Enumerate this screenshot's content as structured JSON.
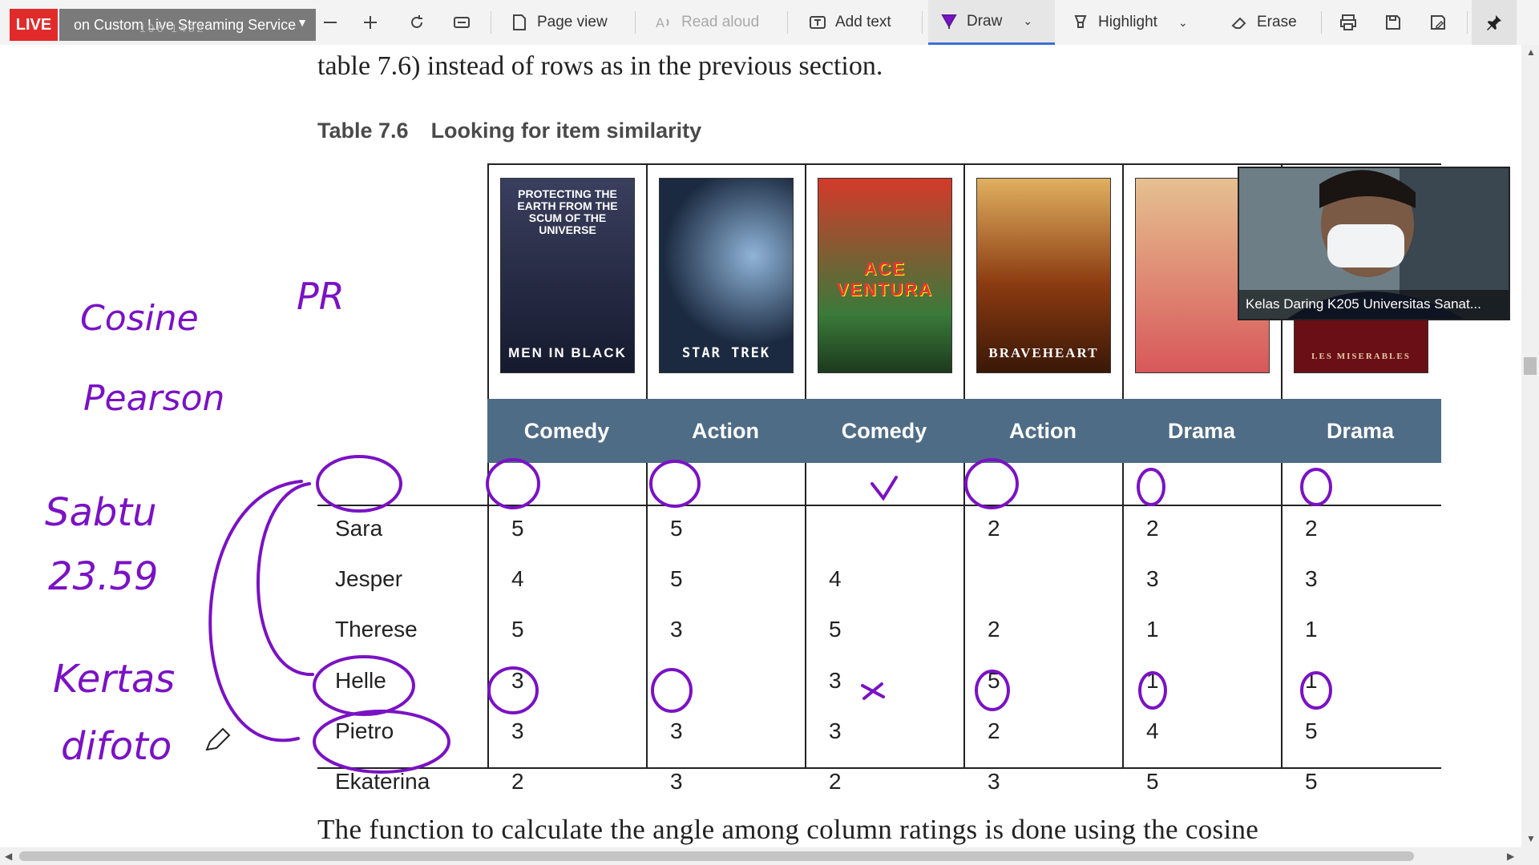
{
  "overlay": {
    "live_label": "LIVE",
    "ghost_text": "196  1432",
    "stream_service": "on Custom Live Streaming Service"
  },
  "toolbar": {
    "page_view": "Page view",
    "read_aloud": "Read aloud",
    "add_text": "Add text",
    "draw": "Draw",
    "highlight": "Highlight",
    "erase": "Erase"
  },
  "document": {
    "top_line": "table 7.6) instead of rows as in the previous section.",
    "table_number": "Table 7.6",
    "table_title": "Looking for item similarity",
    "bottom_line": "The function to calculate the angle among column ratings is done using the cosine",
    "posters": [
      "MEN IN BLACK",
      "STAR TREK",
      "ACE VENTURA",
      "BRAVEHEART",
      "",
      "LES MISERABLES"
    ],
    "genres": [
      "Comedy",
      "Action",
      "Comedy",
      "Action",
      "Drama",
      "Drama"
    ],
    "rows": [
      {
        "name": "Sara",
        "ratings": [
          "5",
          "5",
          "",
          "2",
          "2",
          "2"
        ]
      },
      {
        "name": "Jesper",
        "ratings": [
          "4",
          "5",
          "4",
          "",
          "3",
          "3"
        ]
      },
      {
        "name": "Therese",
        "ratings": [
          "5",
          "3",
          "5",
          "2",
          "1",
          "1"
        ]
      },
      {
        "name": "Helle",
        "ratings": [
          "3",
          "",
          "3",
          "5",
          "1",
          "1"
        ]
      },
      {
        "name": "Pietro",
        "ratings": [
          "3",
          "3",
          "3",
          "2",
          "4",
          "5"
        ]
      },
      {
        "name": "Ekaterina",
        "ratings": [
          "2",
          "3",
          "2",
          "3",
          "5",
          "5"
        ]
      }
    ]
  },
  "annotations": {
    "pr": "PR",
    "cosine": "Cosine",
    "pearson": "Pearson",
    "sabtu": "Sabtu",
    "time": "23.59",
    "kertas": "Kertas",
    "difoto": "difoto",
    "ink_color": "#7a12c4"
  },
  "webcam": {
    "label": "Kelas Daring  K205 Universitas Sanat..."
  }
}
